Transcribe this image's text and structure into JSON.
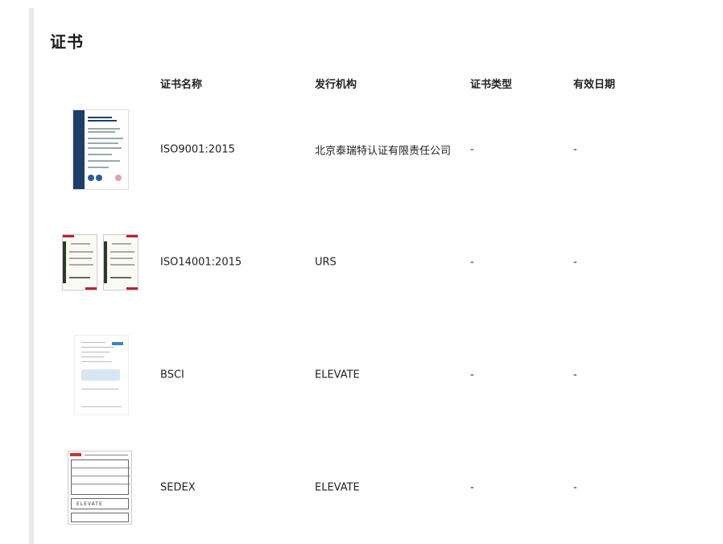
{
  "section": {
    "title": "证书"
  },
  "table": {
    "headers": [
      "证书名称",
      "发行机构",
      "证书类型",
      "有效日期"
    ],
    "rows": [
      {
        "name": "ISO9001:2015",
        "issuer": "北京泰瑞特认证有限责任公司",
        "type": "-",
        "date": "-",
        "thumb": "iso9001-certificate-image"
      },
      {
        "name": "ISO14001:2015",
        "issuer": "URS",
        "type": "-",
        "date": "-",
        "thumb": "iso14001-certificate-image"
      },
      {
        "name": "BSCI",
        "issuer": "ELEVATE",
        "type": "-",
        "date": "-",
        "thumb": "bsci-certificate-image"
      },
      {
        "name": "SEDEX",
        "issuer": "ELEVATE",
        "type": "-",
        "date": "-",
        "thumb": "sedex-certificate-image"
      }
    ]
  },
  "thumb_text": {
    "sedex_logo": "ELEVATE"
  }
}
